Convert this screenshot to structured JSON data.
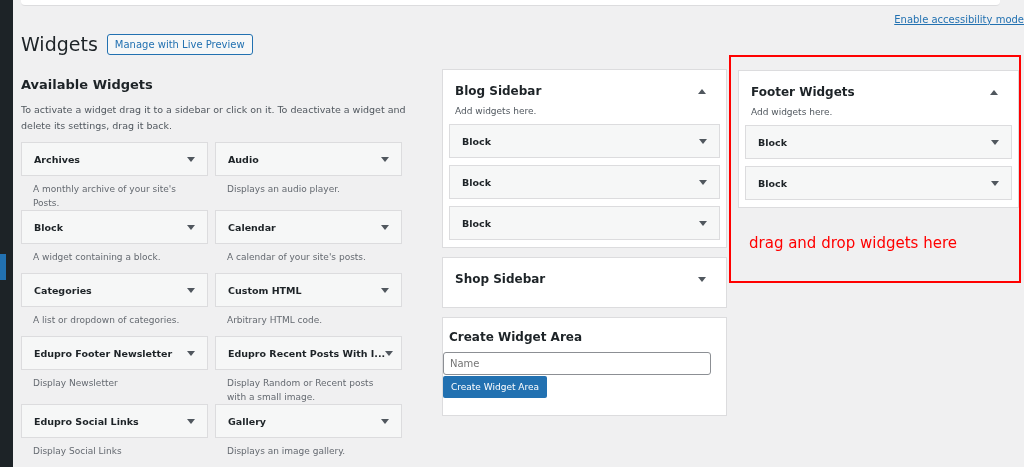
{
  "accessibility_link": "Enable accessibility mode",
  "page": {
    "title": "Widgets",
    "live_preview_button": "Manage with Live Preview"
  },
  "available_widgets": {
    "title": "Available Widgets",
    "description": "To activate a widget drag it to a sidebar or click on it. To deactivate a widget and delete its settings, drag it back.",
    "widgets": [
      {
        "name": "Archives",
        "description": "A monthly archive of your site's Posts."
      },
      {
        "name": "Audio",
        "description": "Displays an audio player."
      },
      {
        "name": "Block",
        "description": "A widget containing a block."
      },
      {
        "name": "Calendar",
        "description": "A calendar of your site's posts."
      },
      {
        "name": "Categories",
        "description": "A list or dropdown of categories."
      },
      {
        "name": "Custom HTML",
        "description": "Arbitrary HTML code."
      },
      {
        "name": "Edupro Footer Newsletter",
        "description": "Display Newsletter"
      },
      {
        "name": "Edupro Recent Posts With I...",
        "description": "Display Random or Recent posts with a small image."
      },
      {
        "name": "Edupro Social Links",
        "description": "Display Social Links"
      },
      {
        "name": "Gallery",
        "description": "Displays an image gallery."
      }
    ]
  },
  "sidebars": [
    {
      "title": "Blog Sidebar",
      "expanded": true,
      "description": "Add widgets here.",
      "widgets": [
        "Block",
        "Block",
        "Block"
      ]
    },
    {
      "title": "Shop Sidebar",
      "expanded": false
    }
  ],
  "create_widget_area": {
    "title": "Create Widget Area",
    "placeholder": "Name",
    "button": "Create Widget Area"
  },
  "footer_sidebar": {
    "title": "Footer Widgets",
    "expanded": true,
    "description": "Add widgets here.",
    "widgets": [
      "Block",
      "Block"
    ]
  },
  "annotation": "drag and drop widgets here"
}
